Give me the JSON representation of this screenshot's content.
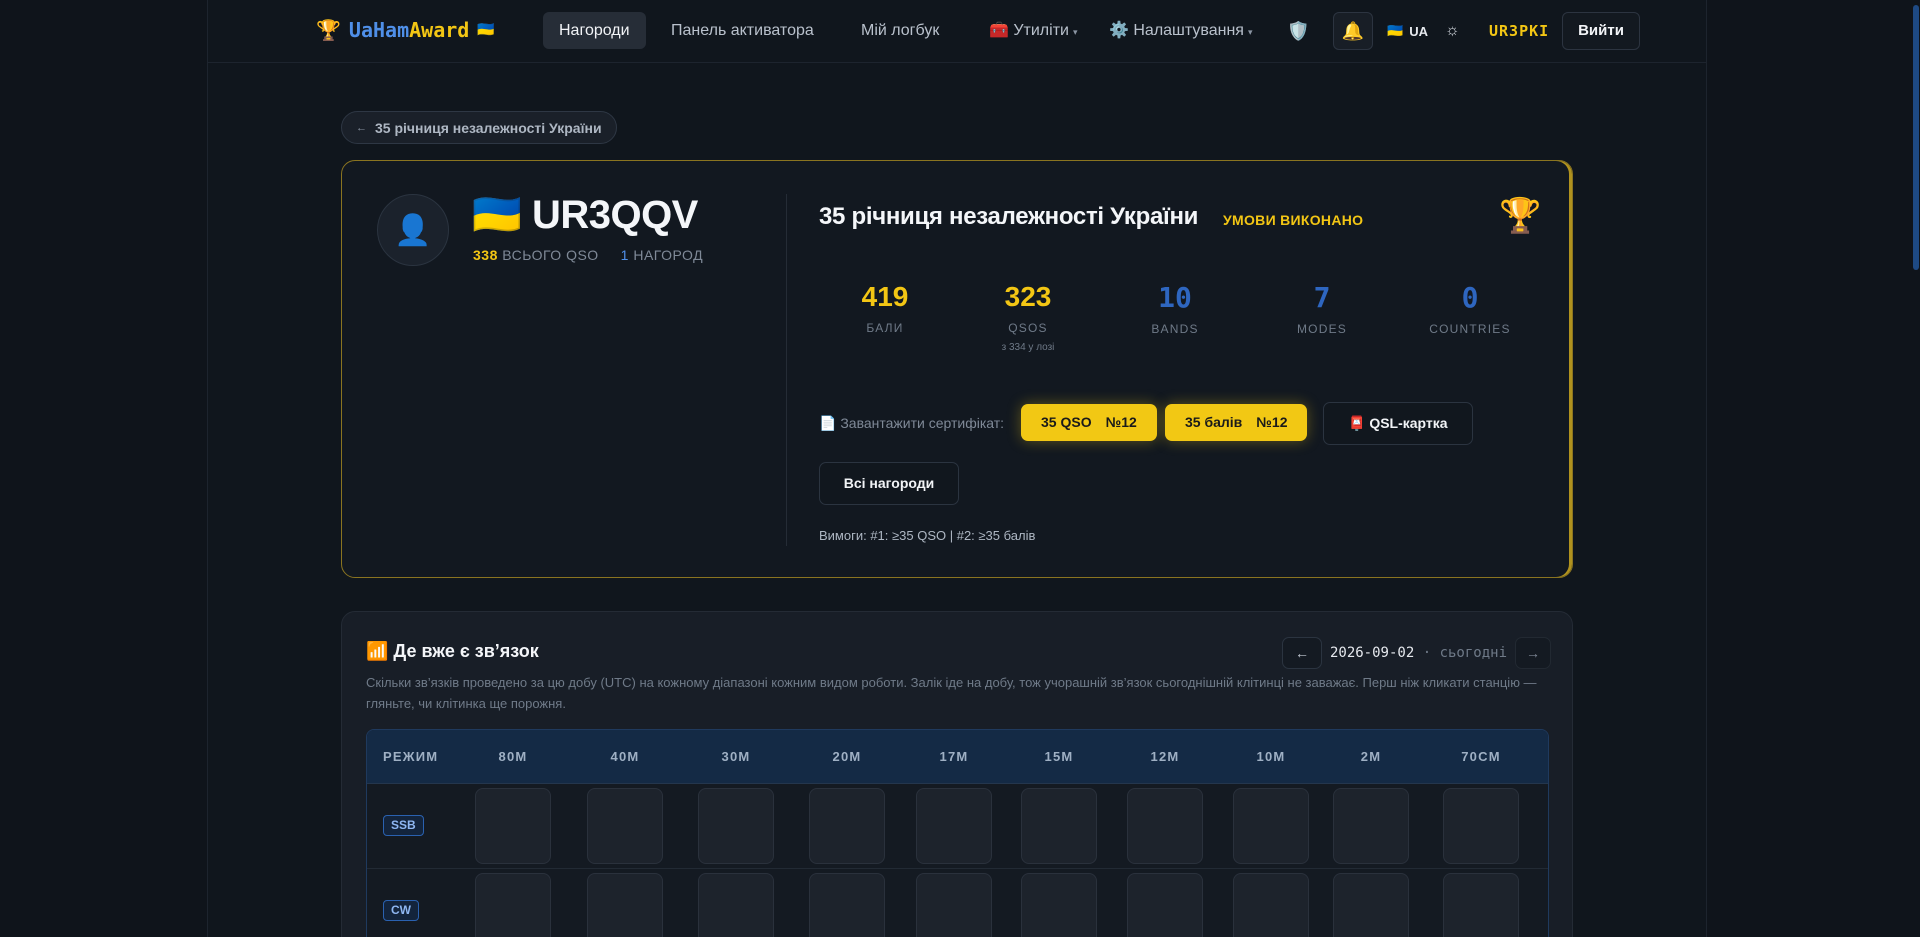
{
  "nav": {
    "brand_part1": "UaHam",
    "brand_part2": "Award",
    "brand_flag": "🇺🇦",
    "brand_trophy": "🏆",
    "items": [
      {
        "label": "Нагороди"
      },
      {
        "label": "Панель активатора"
      },
      {
        "label": "Мій логбук"
      },
      {
        "label": "🧰 Утиліти",
        "caret": "▾"
      },
      {
        "label": "⚙️ Налаштування",
        "caret": "▾"
      }
    ],
    "shield": "🛡️",
    "bell": "🔔",
    "lang_flag": "🇺🇦",
    "lang": "UA",
    "theme_icon": "☼",
    "callsign": "UR3PKI",
    "logout": "Вийти"
  },
  "back": {
    "arrow": "←",
    "label": "35 річниця незалежності України"
  },
  "award": {
    "avatar": "👤",
    "callsign_flag": "🇺🇦",
    "callsign": "UR3QQV",
    "total_qso_value": "338",
    "total_qso_label": "ВСЬОГО QSO",
    "awards_value": "1",
    "awards_label": "НАГОРОД",
    "title": "35 річниця незалежності України",
    "status": "УМОВИ ВИКОНАНО",
    "trophy": "🏆",
    "stats": [
      {
        "value": "419",
        "label": "БАЛИ",
        "sub": "",
        "color": "yellow"
      },
      {
        "value": "323",
        "label": "QSOS",
        "sub": "з 334 у лозі",
        "color": "yellow"
      },
      {
        "value": "10",
        "label": "BANDS",
        "sub": "",
        "color": "blue"
      },
      {
        "value": "7",
        "label": "MODES",
        "sub": "",
        "color": "blue"
      },
      {
        "value": "0",
        "label": "COUNTRIES",
        "sub": "",
        "color": "blue"
      }
    ],
    "cert_label": "📄 Завантажити сертифікат:",
    "cert_buttons": [
      {
        "label": "35 QSO",
        "num": "№12"
      },
      {
        "label": "35 балів",
        "num": "№12"
      }
    ],
    "qsl_button": "📮 QSL-картка",
    "all_awards_button": "Всі нагороди",
    "requirements": "Вимоги: #1: ≥35 QSO | #2: ≥35 балів"
  },
  "where": {
    "title": "📶 Де вже є зв’язок",
    "description": "Скільки зв’язків проведено за цю добу (UTC) на кожному діапазоні кожним видом роботи. Залік іде на добу, тож учорашній зв’язок сьогоднішній клітинці не заважає. Перш ніж кликати станцію — гляньте, чи клітинка ще порожня.",
    "prev": "←",
    "next": "→",
    "date": "2026-09-02",
    "date_sep": " · ",
    "today": "сьогодні",
    "header_mode": "РЕЖИМ",
    "bands": [
      "80M",
      "40M",
      "30M",
      "20M",
      "17M",
      "15M",
      "12M",
      "10M",
      "2M",
      "70CM"
    ],
    "modes": [
      "SSB",
      "CW"
    ]
  },
  "colors": {
    "accent_yellow": "#f3c614",
    "accent_blue": "#2e66c0",
    "background": "#0f141b"
  }
}
